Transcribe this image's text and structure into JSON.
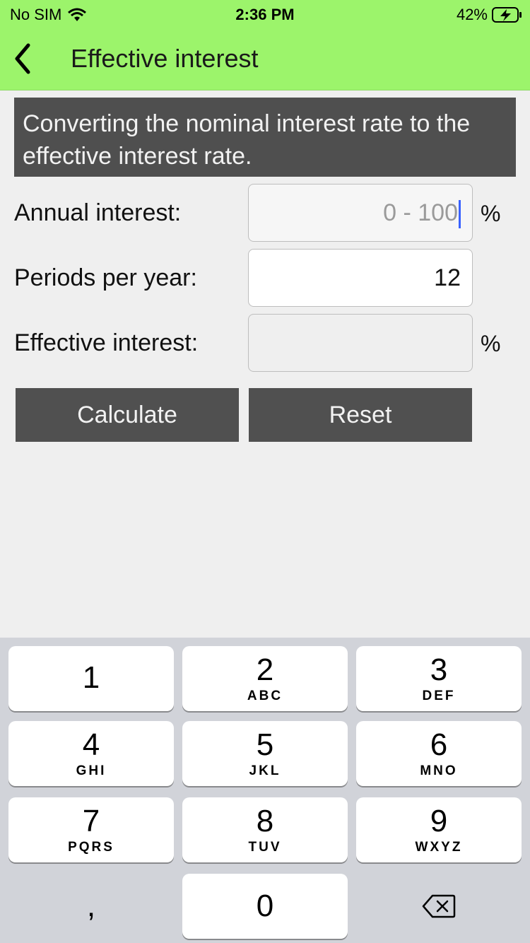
{
  "status": {
    "carrier": "No SIM",
    "time": "2:36 PM",
    "battery": "42%"
  },
  "nav": {
    "title": "Effective interest"
  },
  "banner": {
    "text": "Converting the nominal interest rate to the effective interest rate."
  },
  "form": {
    "annual": {
      "label": "Annual interest:",
      "placeholder": "0 - 100",
      "value": "",
      "unit": "%"
    },
    "periods": {
      "label": "Periods per year:",
      "value": "12"
    },
    "effective": {
      "label": "Effective interest:",
      "value": "",
      "unit": "%"
    }
  },
  "buttons": {
    "calculate": "Calculate",
    "reset": "Reset"
  },
  "keyboard": {
    "keys": [
      {
        "digit": "1",
        "letters": ""
      },
      {
        "digit": "2",
        "letters": "ABC"
      },
      {
        "digit": "3",
        "letters": "DEF"
      },
      {
        "digit": "4",
        "letters": "GHI"
      },
      {
        "digit": "5",
        "letters": "JKL"
      },
      {
        "digit": "6",
        "letters": "MNO"
      },
      {
        "digit": "7",
        "letters": "PQRS"
      },
      {
        "digit": "8",
        "letters": "TUV"
      },
      {
        "digit": "9",
        "letters": "WXYZ"
      },
      {
        "digit": "0",
        "letters": ""
      }
    ],
    "comma": ","
  },
  "colors": {
    "accent": "#9cf46b",
    "dark": "#505050",
    "caret": "#3a62ff"
  }
}
